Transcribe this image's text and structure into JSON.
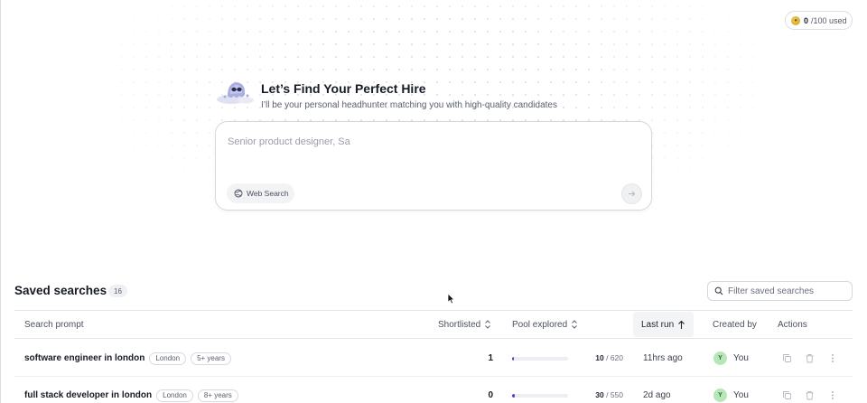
{
  "credits": {
    "used": "0",
    "limit": "/100 used",
    "accent": "#d6a92a"
  },
  "hero": {
    "title": "Let’s Find Your Perfect Hire",
    "subtitle": "I’ll be your personal headhunter matching you with high-quality candidates",
    "mascot_icon": "ghost-mascot-icon"
  },
  "prompt": {
    "placeholder": "Senior product designer, Sa",
    "web_search_label": "Web Search",
    "send_icon": "arrow-right-icon"
  },
  "saved": {
    "title": "Saved searches",
    "count": "16",
    "filter_placeholder": "Filter saved searches",
    "columns": {
      "prompt": "Search prompt",
      "shortlisted": "Shortlisted",
      "pool": "Pool explored",
      "last_run": "Last run",
      "created_by": "Created by",
      "actions": "Actions"
    },
    "rows": [
      {
        "prompt": "software engineer in london",
        "tags": [
          "London",
          "5+ years"
        ],
        "shortlisted": "1",
        "pool_done": "10",
        "pool_total": "/ 620",
        "pool_fraction": 0.016,
        "last_run": "11hrs ago",
        "avatar": "Y",
        "creator": "You"
      },
      {
        "prompt": "full stack developer in london",
        "tags": [
          "London",
          "8+ years"
        ],
        "shortlisted": "0",
        "pool_done": "30",
        "pool_total": "/ 550",
        "pool_fraction": 0.055,
        "last_run": "2d ago",
        "avatar": "Y",
        "creator": "You"
      }
    ]
  },
  "colors": {
    "progress": "#4b45c6",
    "avatar_bg": "#b7e7b9",
    "text": "#1f2430"
  }
}
